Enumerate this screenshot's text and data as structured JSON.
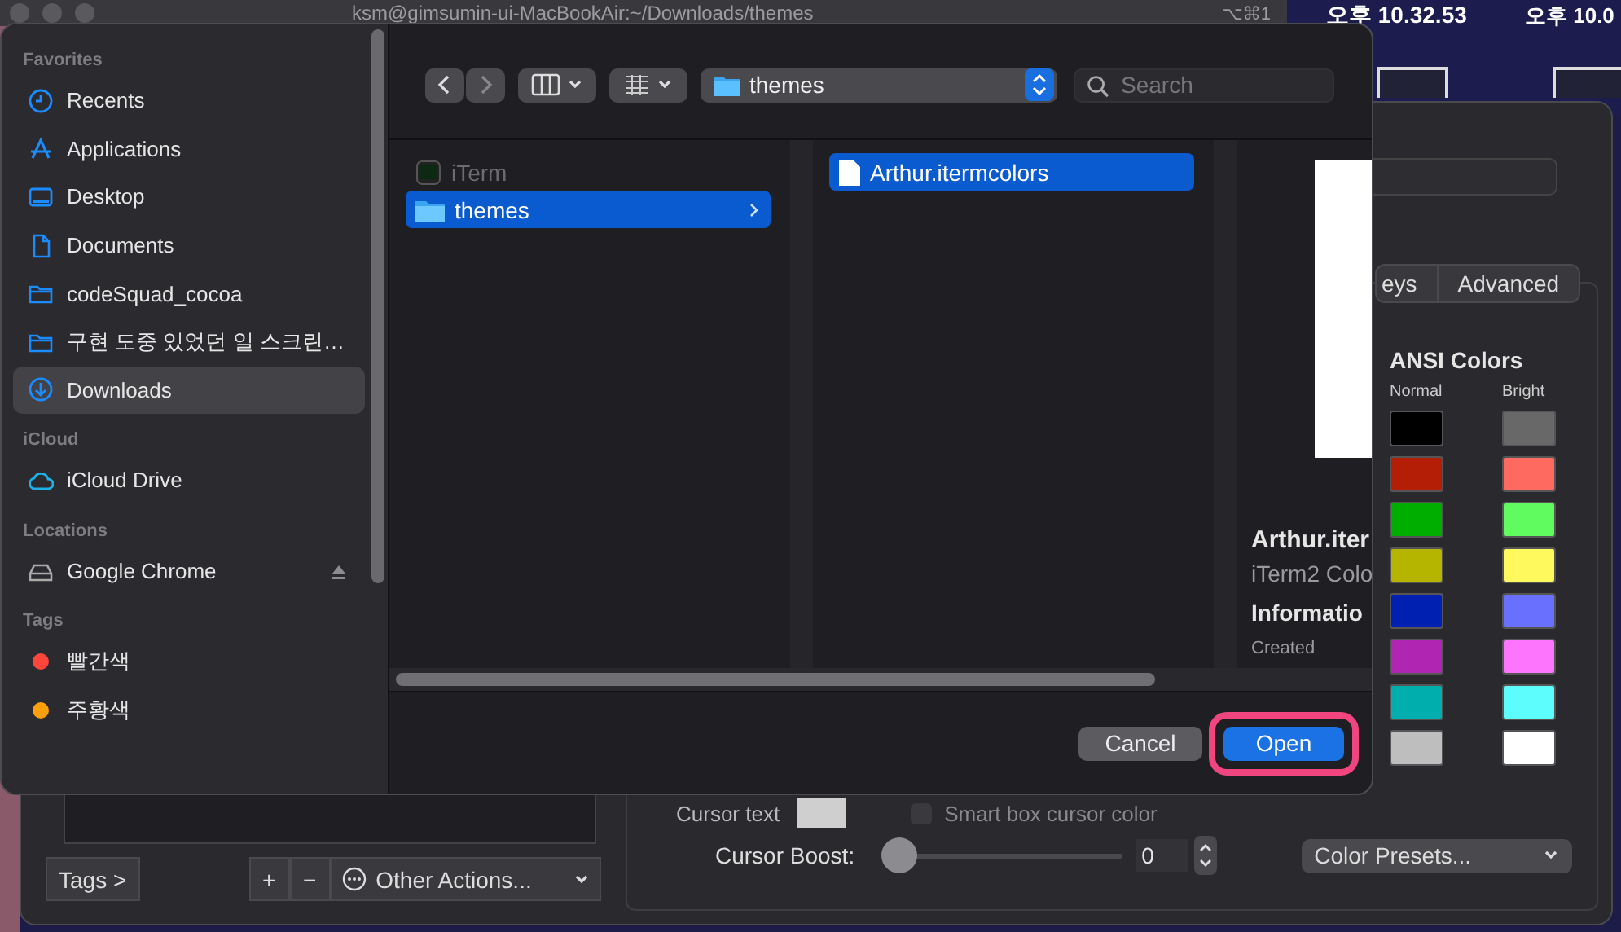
{
  "desktop": {
    "clocks": [
      "오후 10.32.53",
      "오후 10.0"
    ]
  },
  "terminal": {
    "title": "ksm@gimsumin-ui-MacBookAir:~/Downloads/themes",
    "shortcut": "⌥⌘1"
  },
  "preferences": {
    "tabs": [
      {
        "label": "eys",
        "selected": false
      },
      {
        "label": "Advanced",
        "selected": false
      }
    ],
    "ansi": {
      "title": "ANSI Colors",
      "normal_label": "Normal",
      "bright_label": "Bright",
      "normal": [
        {
          "color": "#000000"
        },
        {
          "color": "#b41d06"
        },
        {
          "color": "#00ae00"
        },
        {
          "color": "#b5b500"
        },
        {
          "color": "#0020b2"
        },
        {
          "color": "#b025b2"
        },
        {
          "color": "#00aeae"
        },
        {
          "color": "#bebebe"
        }
      ],
      "bright": [
        {
          "color": "#686868"
        },
        {
          "color": "#fe6a60"
        },
        {
          "color": "#5ffb5f"
        },
        {
          "color": "#fefa5e"
        },
        {
          "color": "#6970fd"
        },
        {
          "color": "#fd75fd"
        },
        {
          "color": "#5efdfd"
        },
        {
          "color": "#ffffff"
        }
      ]
    },
    "cursor_text": {
      "label": "Cursor text"
    },
    "smart_box": {
      "label": "Smart box cursor color",
      "checked": false
    },
    "cursor_boost": {
      "label": "Cursor Boost:",
      "level": 0,
      "value": "0"
    },
    "color_presets": "Color Presets...",
    "tags_button": "Tags >",
    "add_button": "+",
    "remove_button": "−",
    "other_actions": "Other Actions..."
  },
  "dialog": {
    "sidebar": [
      {
        "heading": "Favorites",
        "items": [
          {
            "label": "Recents",
            "kind": "clock",
            "selected": false
          },
          {
            "label": "Applications",
            "kind": "apps",
            "selected": false
          },
          {
            "label": "Desktop",
            "kind": "desktop",
            "selected": false
          },
          {
            "label": "Documents",
            "kind": "document",
            "selected": false
          },
          {
            "label": "codeSquad_cocoa",
            "kind": "folder",
            "selected": false
          },
          {
            "label": "구현 도중 있었던 일 스크린…",
            "kind": "folder",
            "selected": false
          },
          {
            "label": "Downloads",
            "kind": "download",
            "selected": true
          }
        ]
      },
      {
        "heading": "iCloud",
        "items": [
          {
            "label": "iCloud Drive",
            "kind": "cloud",
            "selected": false
          }
        ]
      },
      {
        "heading": "Locations",
        "items": [
          {
            "label": "Google Chrome",
            "kind": "drive",
            "selected": false,
            "eject": true
          }
        ]
      },
      {
        "heading": "Tags",
        "items": [
          {
            "label": "빨간색",
            "kind": "tag",
            "color": "#ff453a",
            "selected": false
          },
          {
            "label": "주황색",
            "kind": "tag",
            "color": "#ff9f0a",
            "selected": false
          }
        ]
      }
    ],
    "location": "themes",
    "search_placeholder": "Search",
    "columns": [
      [
        {
          "label": "iTerm",
          "kind": "app",
          "selected": false,
          "disabled": true
        },
        {
          "label": "themes",
          "kind": "folder",
          "selected": true,
          "disabled": false
        }
      ],
      [
        {
          "label": "Arthur.itermcolors",
          "kind": "file",
          "selected": true,
          "disabled": false
        }
      ]
    ],
    "preview": {
      "name": "Arthur.iter",
      "type": "iTerm2 Colo",
      "heading": "Informatio",
      "created": "Created"
    },
    "cancel": "Cancel",
    "open": {
      "label": "Open",
      "highlighted": true
    }
  }
}
